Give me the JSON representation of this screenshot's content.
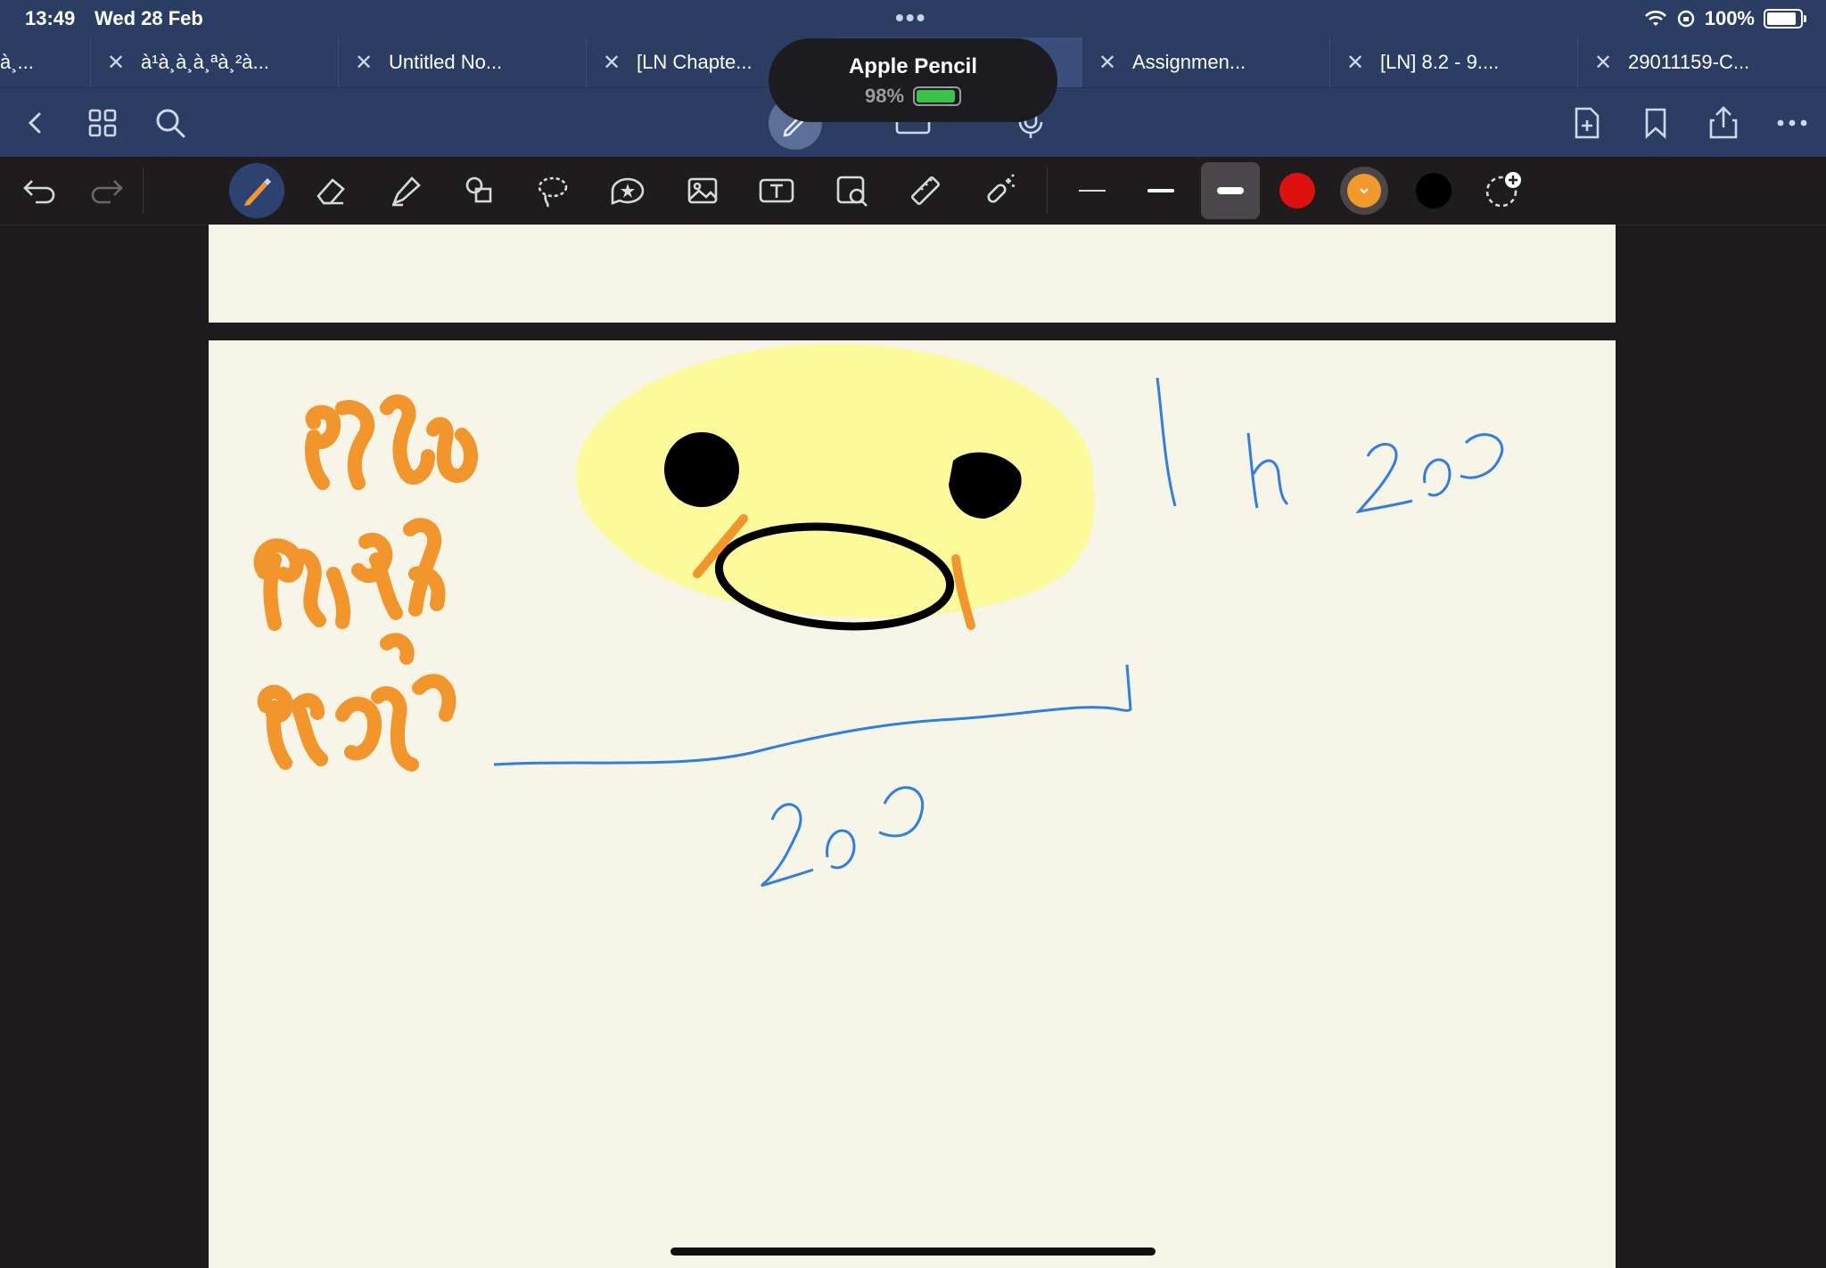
{
  "status_bar": {
    "time": "13:49",
    "date": "Wed 28 Feb",
    "dots": "•••",
    "battery_text": "100%",
    "battery_level": 1.0
  },
  "tabs": [
    {
      "title": "à¸..."
    },
    {
      "title": "à¹à¸à¸à¸ªà¸²à..."
    },
    {
      "title": "Untitled No..."
    },
    {
      "title": "[LN Chapte..."
    },
    {
      "title": ""
    },
    {
      "title": "Assignmen..."
    },
    {
      "title": "[LN] 8.2 - 9...."
    },
    {
      "title": "29011159-C..."
    }
  ],
  "pencil_hud": {
    "title": "Apple Pencil",
    "battery_text": "98%",
    "battery_level": 0.98
  },
  "nav_icons": [
    "back-icon",
    "grid-icon",
    "search-icon",
    "pen-mode-icon",
    "keyboard-icon",
    "microphone-icon",
    "add-page-icon",
    "bookmark-icon",
    "share-icon",
    "more-icon"
  ],
  "tools": [
    "undo-icon",
    "redo-icon",
    "pen-icon",
    "eraser-icon",
    "highlighter-icon",
    "shapes-icon",
    "lasso-icon",
    "sticker-icon",
    "image-icon",
    "text-icon",
    "camera-icon",
    "ruler-icon",
    "laser-icon"
  ],
  "colors": {
    "navy": "#2b3d63",
    "paper": "#f7f4e8",
    "ink_orange": "#f2962b",
    "ink_blue": "#2e7fe0",
    "highlight_yellow": "#fcfa9a",
    "swatch_red": "#e01010",
    "swatch_orange": "#f3982a",
    "swatch_black": "#000000"
  }
}
